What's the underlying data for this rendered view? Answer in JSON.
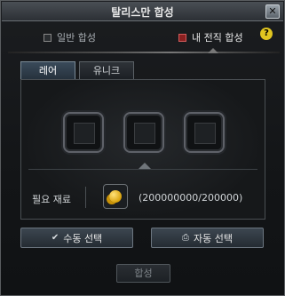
{
  "window": {
    "title": "탈리스만 합성",
    "close_label": "✕"
  },
  "top_tabs": [
    {
      "label": "일반 합성",
      "active": false
    },
    {
      "label": "내 전직 합성",
      "active": true
    }
  ],
  "help_label": "?",
  "sub_tabs": [
    {
      "label": "레어",
      "active": true
    },
    {
      "label": "유니크",
      "active": false
    }
  ],
  "slots": [
    {
      "name": "slot-1"
    },
    {
      "name": "slot-2"
    },
    {
      "name": "slot-3"
    }
  ],
  "requirement": {
    "label": "필요 재료",
    "value": "(200000000/200000)",
    "icon": "gold-coins-icon"
  },
  "buttons": {
    "manual": "수동 선택",
    "auto": "자동 선택",
    "combine": "합성"
  },
  "colors": {
    "accent_red": "#8a2020",
    "help_yellow": "#e0c520",
    "gold": "#d9a20c"
  }
}
